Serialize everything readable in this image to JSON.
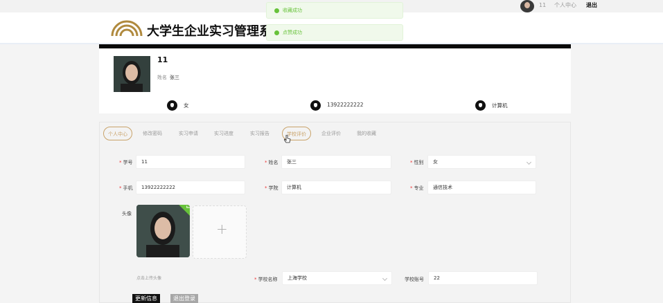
{
  "topbar": {
    "user_id": "11",
    "center_label": "个人中心",
    "logout_label": "退出"
  },
  "header": {
    "site_title": "大学生企业实习管理系"
  },
  "toasts": [
    {
      "text": "收藏成功"
    },
    {
      "text": "点赞成功"
    }
  ],
  "profile": {
    "name": "11",
    "name_label": "姓名",
    "name_value": "张三",
    "info": [
      {
        "icon": "gender-icon",
        "text": "女"
      },
      {
        "icon": "phone-icon",
        "text": "13922222222"
      },
      {
        "icon": "college-icon",
        "text": "计算机"
      }
    ]
  },
  "tabs": [
    {
      "label": "个人中心",
      "state": "active"
    },
    {
      "label": "修改密码",
      "state": "normal"
    },
    {
      "label": "实习申请",
      "state": "normal"
    },
    {
      "label": "实习进度",
      "state": "normal"
    },
    {
      "label": "实习报告",
      "state": "normal"
    },
    {
      "label": "学校评价",
      "state": "hovered"
    },
    {
      "label": "企业评价",
      "state": "normal"
    },
    {
      "label": "我的收藏",
      "state": "normal"
    }
  ],
  "form": {
    "student_no": {
      "label": "学号",
      "value": "11"
    },
    "name": {
      "label": "姓名",
      "value": "张三"
    },
    "gender": {
      "label": "性别",
      "value": "女"
    },
    "phone": {
      "label": "手机",
      "value": "13922222222"
    },
    "college": {
      "label": "学院",
      "value": "计算机"
    },
    "major": {
      "label": "专业",
      "value": "通信技术"
    },
    "avatar": {
      "label": "头像",
      "tip": "点击上传头像"
    },
    "school_name": {
      "label": "学校名称",
      "value": "上海学校"
    },
    "school_account": {
      "label": "学校账号",
      "value": "22"
    }
  },
  "buttons": {
    "update": "更新信息",
    "logout": "退出登录"
  },
  "colors": {
    "accent": "#c9a36a",
    "success": "#67c23a",
    "dark": "#111111"
  }
}
